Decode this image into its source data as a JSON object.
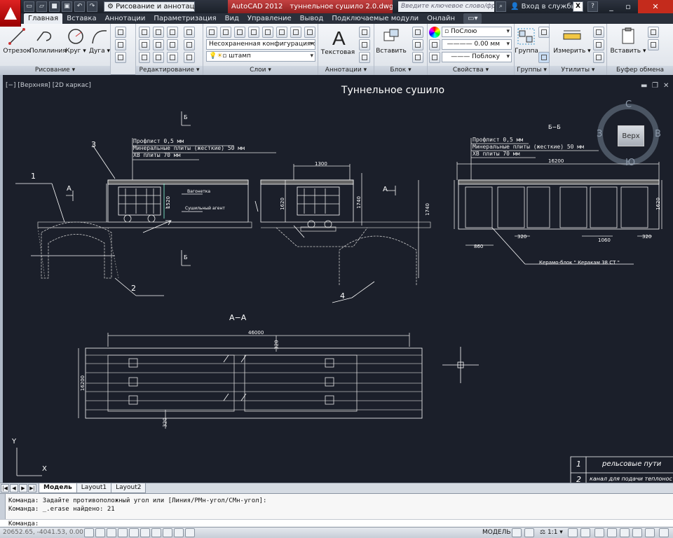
{
  "titlebar": {
    "workspace": "Рисование и аннотации",
    "app_title": "AutoCAD 2012",
    "file_name": "туннельное сушило 2.0.dwg",
    "search_placeholder": "Введите ключевое слово/фразу",
    "signin": "Вход в службы"
  },
  "tabs": [
    "Главная",
    "Вставка",
    "Аннотации",
    "Параметризация",
    "Вид",
    "Управление",
    "Вывод",
    "Подключаемые модули",
    "Онлайн"
  ],
  "ribbon": {
    "draw": {
      "title": "Рисование",
      "line": "Отрезок",
      "polyline": "Полилиния",
      "circle": "Круг",
      "arc": "Дуга"
    },
    "modify": {
      "title": "Редактирование"
    },
    "layers": {
      "title": "Слои",
      "layer_state": "Несохраненная конфигурация слое",
      "current_layer": "штамп"
    },
    "annotation": {
      "title": "Аннотации",
      "text": "Текстовая"
    },
    "block": {
      "title": "Блок",
      "insert": "Вставить"
    },
    "properties": {
      "title": "Свойства",
      "color": "ПоСлою",
      "lineweight": "0.00 мм",
      "linetype": "Поблоку"
    },
    "groups": {
      "title": "Группы",
      "group": "Группа"
    },
    "utilities": {
      "title": "Утилиты",
      "measure": "Измерить"
    },
    "clipboard": {
      "title": "Буфер обмена",
      "paste": "Вставить"
    }
  },
  "viewport": {
    "label": "[−] [Верхняя] [2D каркас]",
    "drawing_title": "Туннельное сушило",
    "viewcube": {
      "top": "Верх",
      "n": "С",
      "s": "Ю",
      "w": "З",
      "e": "В"
    }
  },
  "drawing": {
    "section_bb_mark": "Б",
    "section_bb_title": "Б−Б",
    "section_aa_mark": "А",
    "section_aa_title": "А−А",
    "layers_note": [
      "Профлист 0,5 мм",
      "Минеральные плиты (жесткие) 50 мм",
      "ХВ плиты 70 мм"
    ],
    "callouts": [
      "1",
      "2",
      "3",
      "4"
    ],
    "label_wagon": "Вагонетка",
    "label_agent": "Сушильный агент",
    "dims_left": {
      "h1520": "1520"
    },
    "dims_mid": {
      "w1300": "1300",
      "h1620": "1620",
      "h1740": "1740",
      "h1740b": "1740"
    },
    "dims_right": {
      "w16200": "16200",
      "h1620": "1620",
      "d860": "860",
      "d320": "320",
      "d1060": "1060",
      "d320b": "320"
    },
    "ceramic_block": "Керамо-блок \" Керакам 38 СТ \"",
    "plan": {
      "length": "46000",
      "width": "16200",
      "d320a": "320",
      "d320b": "320"
    },
    "ucs": {
      "x": "X",
      "y": "Y"
    },
    "legend": [
      {
        "no": "1",
        "text": "рельсовые пути"
      },
      {
        "no": "2",
        "text": "канал для подачи теплонос"
      }
    ]
  },
  "layout_tabs": [
    "Модель",
    "Layout1",
    "Layout2"
  ],
  "command": {
    "history": [
      "Команда: Задайте противоположный угол или [Линия/РМн-угол/СМн-угол]:",
      "Команда: _.erase найдено: 21"
    ],
    "prompt": "Команда:"
  },
  "status": {
    "coords": "20652.65, -4041.53, 0.00",
    "model": "МОДЕЛЬ",
    "scale": "1:1"
  }
}
